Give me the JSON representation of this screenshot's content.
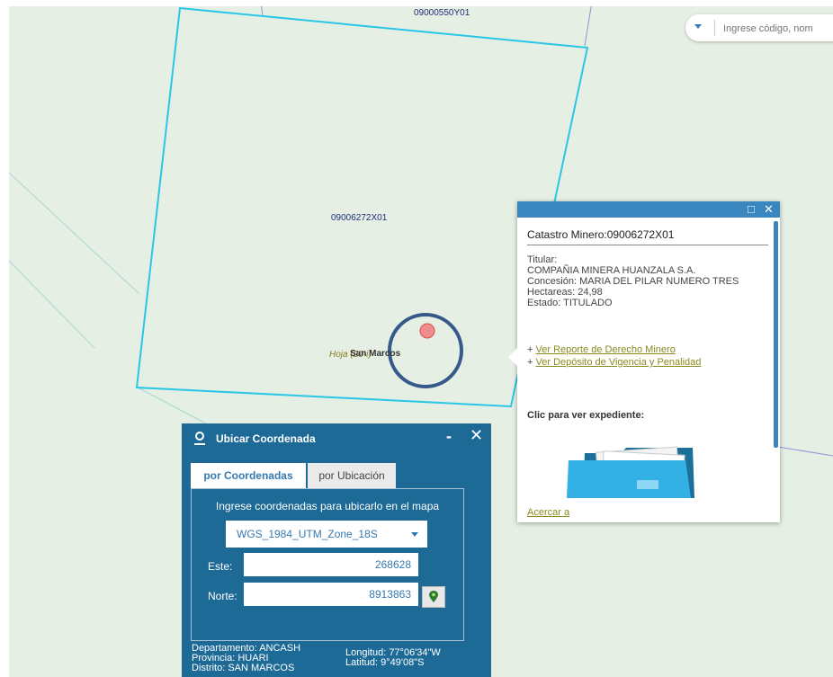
{
  "map": {
    "label_top": "09000550Y01",
    "label_main": "09006272X01",
    "hoja_label": "Hoja (20-i)",
    "town_label": "San Marcos",
    "colors": {
      "background": "#e6efe3",
      "parcel": "#2ac6e8",
      "grid": "#8c95d6",
      "marker": "#f28b8b",
      "ring": "#36598c"
    }
  },
  "search": {
    "placeholder": "Ingrese código, nom"
  },
  "popup": {
    "title": "Catastro Minero:09006272X01",
    "titular_label": "Titular:",
    "titular_value": "COMPAÑIA MINERA HUANZALA S.A.",
    "concesion": "Concesión: MARIA DEL PILAR NUMERO TRES",
    "hectareas": "Hectareas: 24,98",
    "estado": "Estado:  TITULADO",
    "link1_prefix": "+",
    "link1": "Ver Reporte de Derecho Minero",
    "link2_prefix": "+",
    "link2": "Ver Depósito de Vigencia y Penalidad",
    "clic": "Clic para ver expediente:",
    "acercar": "Acercar a",
    "icons": [
      "maximize-icon",
      "close-icon",
      "folder-icon"
    ]
  },
  "panel": {
    "title": "Ubicar Coordenada",
    "minimize": "-",
    "close": "✕",
    "tabs": [
      {
        "label": "por Coordenadas",
        "active": true
      },
      {
        "label": "por Ubicación",
        "active": false
      }
    ],
    "instructions": "Ingrese coordenadas para ubicarlo en el mapa",
    "projection": "WGS_1984_UTM_Zone_18S",
    "este_label": "Este:",
    "este_value": "268628",
    "norte_label": "Norte:",
    "norte_value": "8913863",
    "departamento": "Departamento: ANCASH",
    "provincia": "Provincia: HUARI",
    "distrito": "Distrito: SAN MARCOS",
    "longitud": "Longitud: 77°06'34\"W",
    "latitud": "Latitud: 9°49'08\"S",
    "colors": {
      "panel": "#1d6a97",
      "accent": "#3579b1"
    }
  }
}
